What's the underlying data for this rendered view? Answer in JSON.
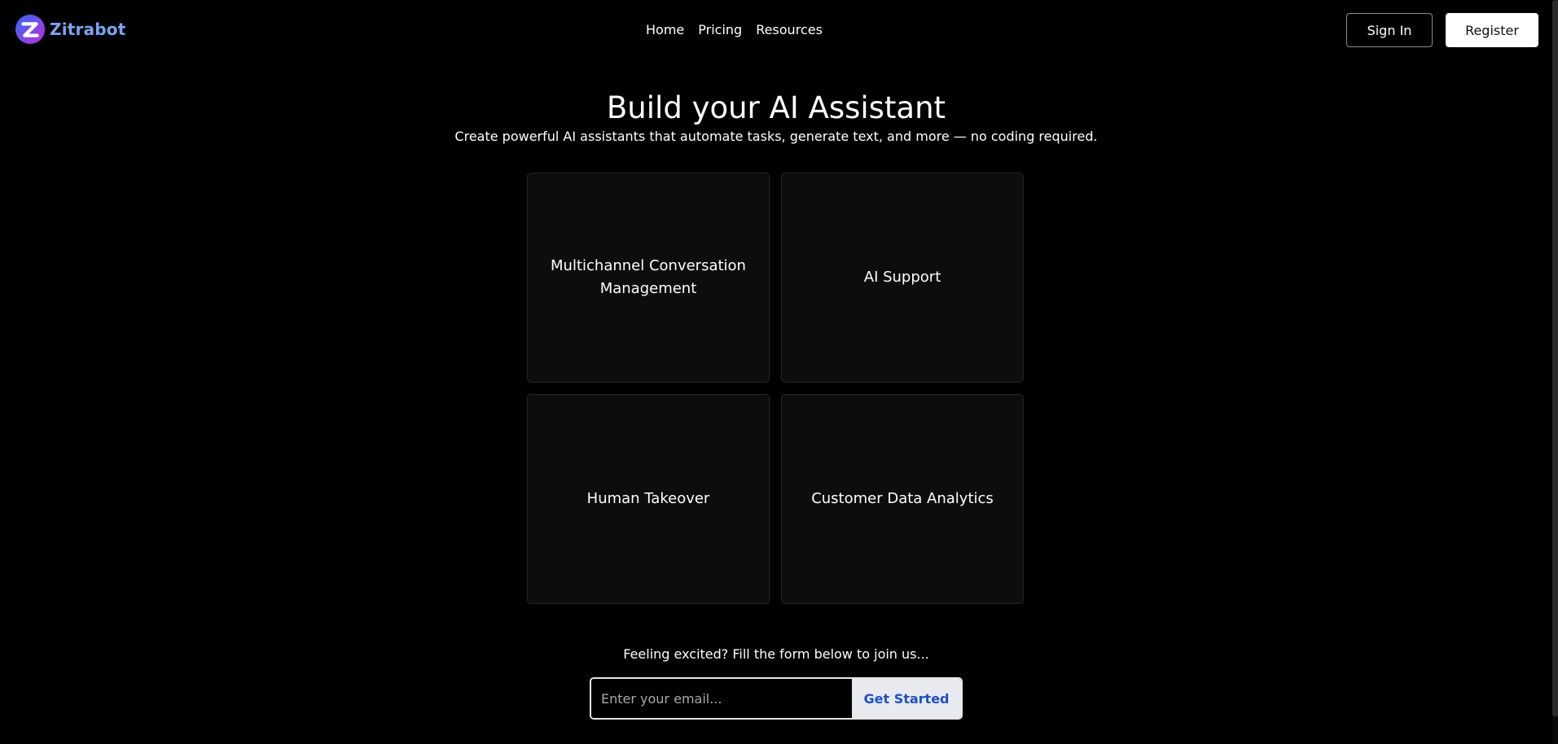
{
  "brand": {
    "name": "Zitrabot",
    "logo_icon": "zitrabot-logo-icon",
    "colors": {
      "name": "#7ba4f2",
      "logo_start": "#2b6ef2",
      "logo_end": "#c22ae0"
    }
  },
  "nav": {
    "items": [
      {
        "label": "Home"
      },
      {
        "label": "Pricing"
      },
      {
        "label": "Resources"
      }
    ]
  },
  "auth": {
    "sign_in_label": "Sign In",
    "register_label": "Register"
  },
  "hero": {
    "title": "Build your AI Assistant",
    "subtitle": "Create powerful AI assistants that automate tasks, generate text, and more — no coding required."
  },
  "features": [
    {
      "label": "Multichannel Conversation Management"
    },
    {
      "label": "AI Support"
    },
    {
      "label": "Human Takeover"
    },
    {
      "label": "Customer Data Analytics"
    }
  ],
  "signup": {
    "prompt": "Feeling excited? Fill the form below to join us...",
    "email_value": "",
    "email_placeholder": "Enter your email...",
    "button_label": "Get Started",
    "button_color": "#1e4fc4"
  }
}
